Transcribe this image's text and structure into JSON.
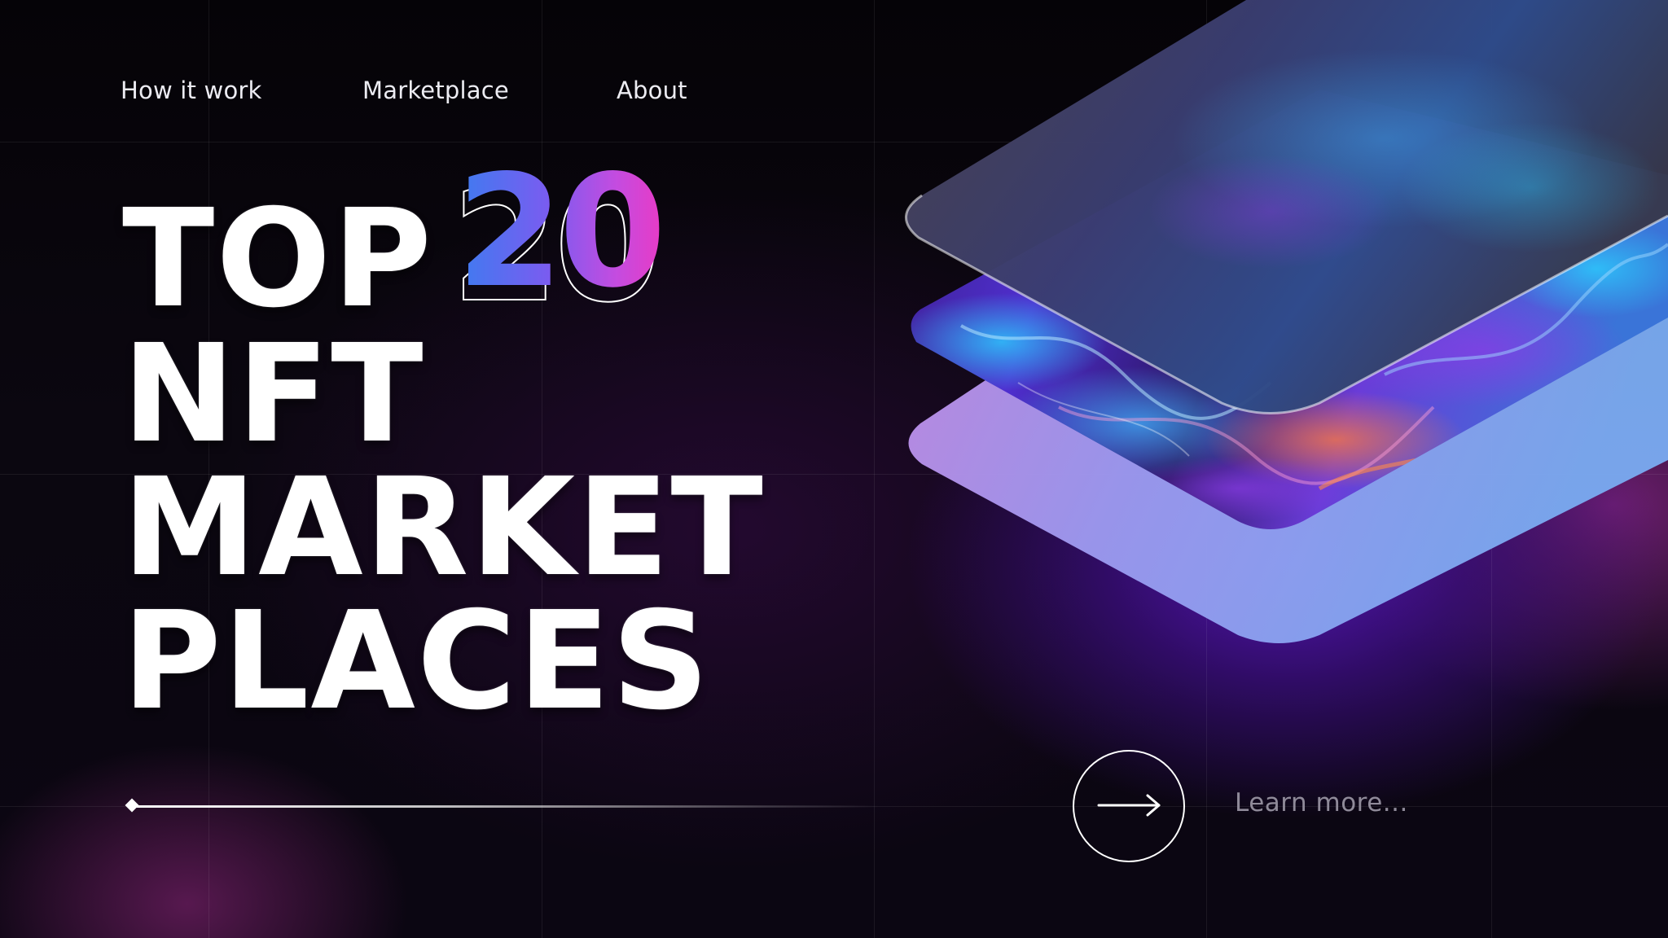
{
  "nav": {
    "items": [
      {
        "label": "How it work"
      },
      {
        "label": "Marketplace"
      },
      {
        "label": "About"
      }
    ]
  },
  "hero": {
    "line1": "TOP",
    "number": "20",
    "line2": "NFT",
    "line3": "MARKET",
    "line4": "PLACES"
  },
  "cta": {
    "learn_more": "Learn more...",
    "arrow_icon": "arrow-right-icon"
  },
  "slider": {
    "progress": 0.0
  },
  "colors": {
    "background": "#07050a",
    "accent_blue": "#3d7cf0",
    "accent_pink": "#e73bc6",
    "glow_purple": "#5816be",
    "card_gradient_start": "#c58ae8",
    "card_gradient_end": "#7aa8ec"
  }
}
